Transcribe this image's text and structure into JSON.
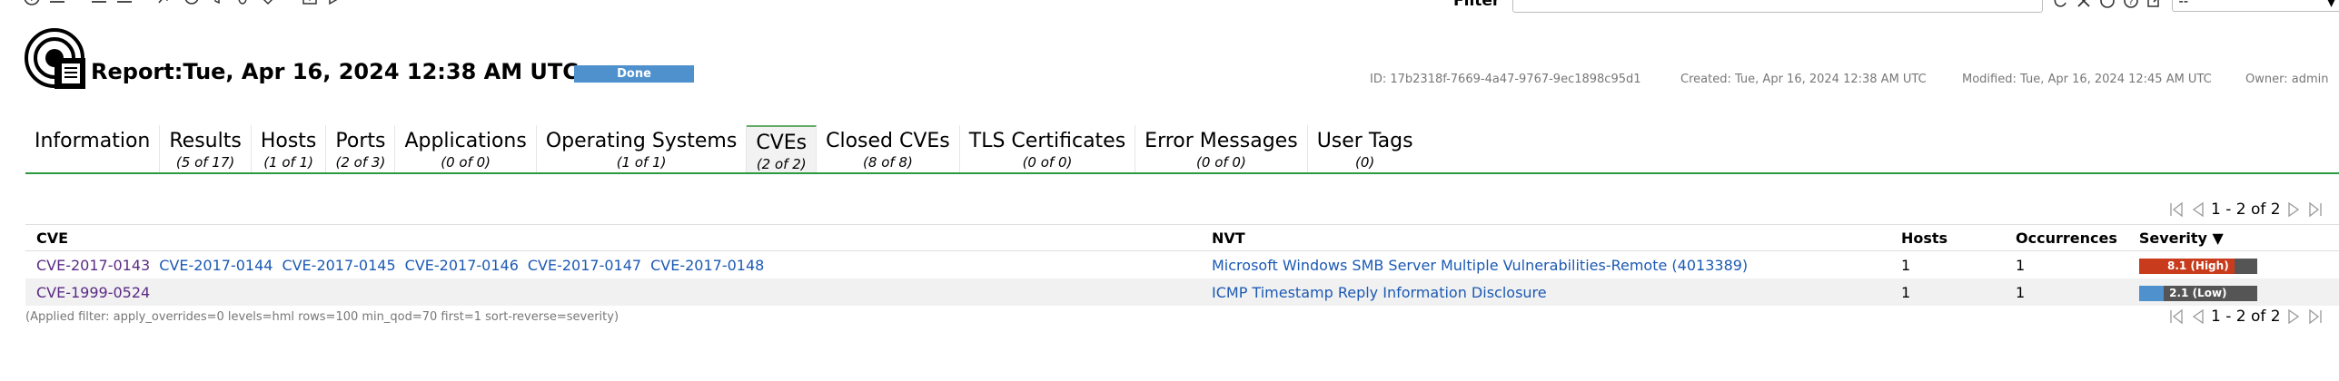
{
  "toolbar": {
    "icons": [
      "help-icon",
      "list-icon",
      "list-alt-icon",
      "list-alt2-icon",
      "performance-icon",
      "delta-icon",
      "filter-icon",
      "bug-icon",
      "tag-icon",
      "download-icon",
      "upload-icon"
    ]
  },
  "filter": {
    "label": "Filter",
    "value": "",
    "select_value": "--"
  },
  "report": {
    "title": "Report:Tue, Apr 16, 2024 12:38 AM UTC",
    "status": "Done",
    "id": "ID: 17b2318f-7669-4a47-9767-9ec1898c95d1",
    "created": "Created: Tue, Apr 16, 2024 12:38 AM UTC",
    "modified": "Modified: Tue, Apr 16, 2024 12:45 AM UTC",
    "owner": "Owner: admin"
  },
  "tabs": [
    {
      "title": "Information",
      "count": ""
    },
    {
      "title": "Results",
      "count": "(5 of 17)"
    },
    {
      "title": "Hosts",
      "count": "(1 of 1)"
    },
    {
      "title": "Ports",
      "count": "(2 of 3)"
    },
    {
      "title": "Applications",
      "count": "(0 of 0)"
    },
    {
      "title": "Operating Systems",
      "count": "(1 of 1)"
    },
    {
      "title": "CVEs",
      "count": "(2 of 2)"
    },
    {
      "title": "Closed CVEs",
      "count": "(8 of 8)"
    },
    {
      "title": "TLS Certificates",
      "count": "(0 of 0)"
    },
    {
      "title": "Error Messages",
      "count": "(0 of 0)"
    },
    {
      "title": "User Tags",
      "count": "(0)"
    }
  ],
  "pagination": {
    "text": "1 - 2 of 2"
  },
  "table": {
    "headers": {
      "cve": "CVE",
      "nvt": "NVT",
      "hosts": "Hosts",
      "occurrences": "Occurrences",
      "severity": "Severity ▼"
    },
    "rows": [
      {
        "cves": [
          "CVE-2017-0143",
          "CVE-2017-0144",
          "CVE-2017-0145",
          "CVE-2017-0146",
          "CVE-2017-0147",
          "CVE-2017-0148"
        ],
        "nvt": "Microsoft Windows SMB Server Multiple Vulnerabilities-Remote (4013389)",
        "hosts": "1",
        "occurrences": "1",
        "severity_label": "8.1 (High)",
        "severity_value": 8.1,
        "severity_color": "#c83b1c"
      },
      {
        "cves": [
          "CVE-1999-0524"
        ],
        "nvt": "ICMP Timestamp Reply Information Disclosure",
        "hosts": "1",
        "occurrences": "1",
        "severity_label": "2.1 (Low)",
        "severity_value": 2.1,
        "severity_color": "#4f91cd"
      }
    ]
  },
  "applied_filter": "(Applied filter: apply_overrides=0 levels=hml rows=100 min_qod=70 first=1 sort-reverse=severity)"
}
